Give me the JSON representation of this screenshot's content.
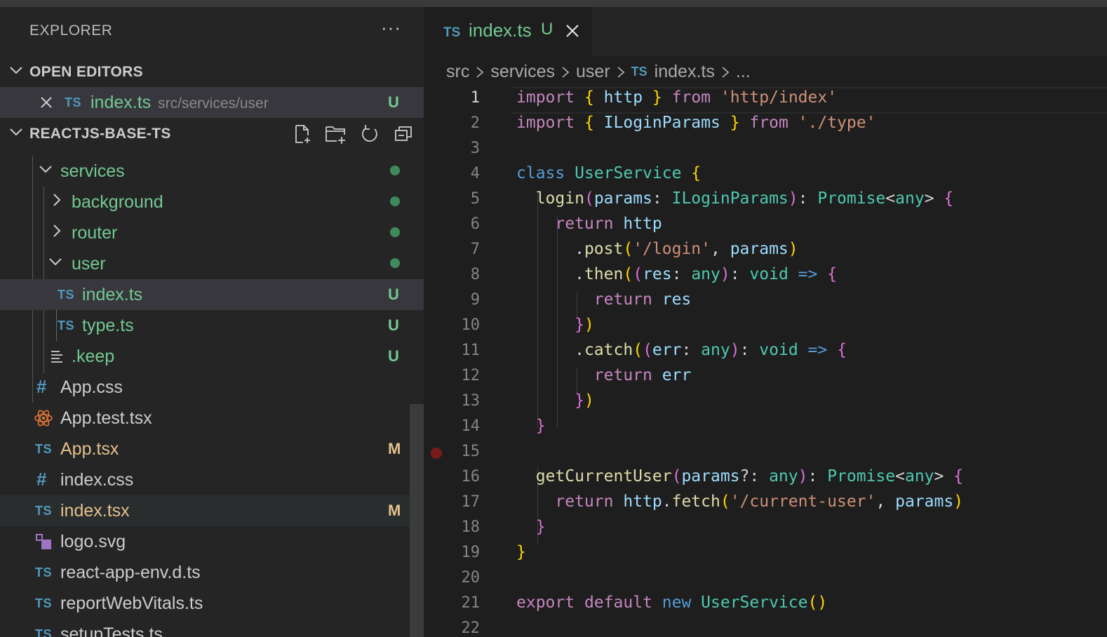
{
  "explorer": {
    "title": "EXPLORER",
    "more": "···"
  },
  "open_editors": {
    "label": "OPEN EDITORS",
    "items": [
      {
        "icon": "TS",
        "name": "index.ts",
        "path": "src/services/user",
        "status": "U"
      }
    ]
  },
  "project": {
    "label": "REACTJS-BASE-TS",
    "actions": [
      "new-file-icon",
      "new-folder-icon",
      "refresh-icon",
      "collapse-all-icon"
    ]
  },
  "tree": {
    "services": "services",
    "background": "background",
    "router": "router",
    "user": "user",
    "user_index": "index.ts",
    "user_index_status": "U",
    "user_type": "type.ts",
    "user_type_status": "U",
    "keep": ".keep",
    "keep_status": "U",
    "app_css": "App.css",
    "app_test": "App.test.tsx",
    "app_tsx": "App.tsx",
    "app_tsx_status": "M",
    "index_css": "index.css",
    "index_tsx": "index.tsx",
    "index_tsx_status": "M",
    "logo": "logo.svg",
    "env": "react-app-env.d.ts",
    "vitals": "reportWebVitals.ts",
    "setup": "setupTests.ts",
    "ts_icon": "TS",
    "hash_icon": "#"
  },
  "tab": {
    "icon": "TS",
    "name": "index.ts",
    "status": "U"
  },
  "breadcrumb": {
    "c1": "src",
    "c2": "services",
    "c3": "user",
    "icon": "TS",
    "c4": "index.ts",
    "c5": "..."
  },
  "editor": {
    "current_line": 1,
    "breakpoint_line": 15,
    "line_numbers": [
      "1",
      "2",
      "3",
      "4",
      "5",
      "6",
      "7",
      "8",
      "9",
      "10",
      "11",
      "12",
      "13",
      "14",
      "15",
      "16",
      "17",
      "18",
      "19",
      "20",
      "21",
      "22"
    ],
    "code": {
      "l1": [
        "import",
        "{",
        "http",
        "}",
        "from",
        "'http/index'"
      ],
      "l2": [
        "import",
        "{",
        "ILoginParams",
        "}",
        "from",
        "'./type'"
      ],
      "l4": [
        "class",
        "UserService",
        "{"
      ],
      "l5": [
        "login",
        "(",
        "params",
        ": ",
        "ILoginParams",
        ")",
        ": ",
        "Promise",
        "<",
        "any",
        "> ",
        "{"
      ],
      "l6": [
        "return",
        "http"
      ],
      "l7": [
        ".",
        "post",
        "(",
        "'/login'",
        ", ",
        "params",
        ")"
      ],
      "l8": [
        ".",
        "then",
        "(",
        "(",
        "res",
        ": ",
        "any",
        ")",
        ": ",
        "void",
        "=>",
        "{"
      ],
      "l9": [
        "return",
        "res"
      ],
      "l10": [
        "}",
        ")"
      ],
      "l11": [
        ".",
        "catch",
        "(",
        "(",
        "err",
        ": ",
        "any",
        ")",
        ": ",
        "void",
        "=>",
        "{"
      ],
      "l12": [
        "return",
        "err"
      ],
      "l13": [
        "}",
        ")"
      ],
      "l14": [
        "}"
      ],
      "l16": [
        "getCurrentUser",
        "(",
        "params",
        "?: ",
        "any",
        ")",
        ": ",
        "Promise",
        "<",
        "any",
        "> ",
        "{"
      ],
      "l17": [
        "return",
        "http",
        ".",
        "fetch",
        "(",
        "'/current-user'",
        ", ",
        "params",
        ")"
      ],
      "l18": [
        "}"
      ],
      "l19": [
        "}"
      ],
      "l21": [
        "export",
        "default",
        "new",
        "UserService",
        "()"
      ]
    }
  }
}
